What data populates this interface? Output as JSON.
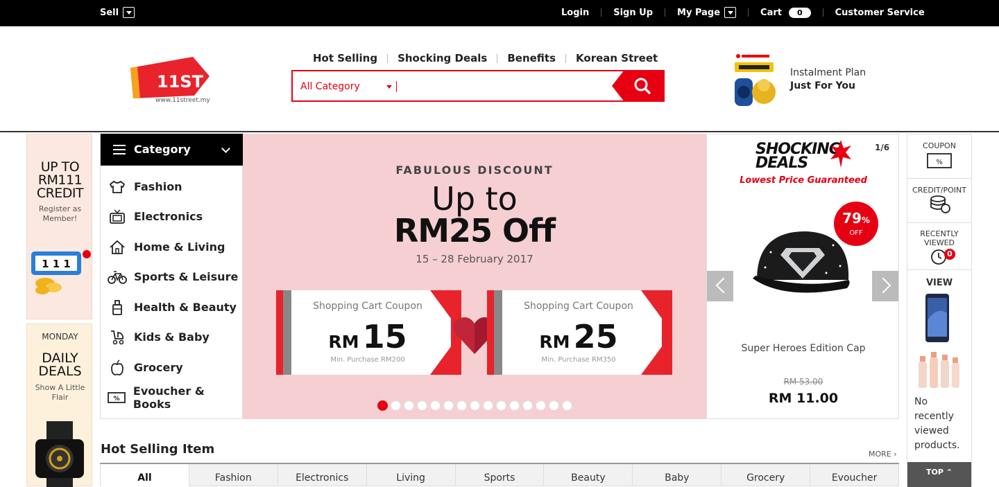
{
  "topbar": {
    "sell": "Sell",
    "login": "Login",
    "signup": "Sign Up",
    "mypage": "My Page",
    "cart": "Cart",
    "cart_count": "0",
    "customer_service": "Customer Service"
  },
  "header": {
    "logo_text": "11ST",
    "logo_url": "www.11street.my",
    "quicklinks": [
      "Hot Selling",
      "Shocking Deals",
      "Benefits",
      "Korean Street"
    ],
    "search_category": "All Category",
    "promo_line1": "Instalment Plan",
    "promo_line2": "Just For You"
  },
  "side_banners": {
    "credit_big": "UP TO RM111 CREDIT",
    "credit_small": "Register as Member!",
    "credit_graphic": "1 1 1",
    "daily_day": "MONDAY",
    "daily_big": "DAILY DEALS",
    "daily_small": "Show A Little Flair"
  },
  "category_menu": {
    "title": "Category",
    "items": [
      "Fashion",
      "Electronics",
      "Home & Living",
      "Sports & Leisure",
      "Health & Beauty",
      "Kids & Baby",
      "Grocery",
      "Evoucher & Books"
    ]
  },
  "main_banner": {
    "eyebrow": "FABULOUS DISCOUNT",
    "headline1": "Up to",
    "headline2": "RM25 Off",
    "dates": "15 – 28 February 2017",
    "coupons": [
      {
        "label": "Shopping Cart Coupon",
        "currency": "RM",
        "amount": "15",
        "min": "Min. Purchase RM200"
      },
      {
        "label": "Shopping Cart Coupon",
        "currency": "RM",
        "amount": "25",
        "min": "Min. Purchase RM350"
      }
    ],
    "slide_count": 15,
    "active_slide": 1
  },
  "shocking_deals": {
    "logo_line1": "SHOCKING",
    "logo_line2": "DEALS",
    "pager": "1/6",
    "tagline": "Lowest Price Guaranteed",
    "discount": "79",
    "discount_unit": "%",
    "discount_label": "OFF",
    "product_name": "Super Heroes Edition Cap",
    "old_price": "RM 53.00",
    "new_price": "RM 11.00"
  },
  "quick_bar": {
    "coupon": "COUPON",
    "coupon_icon": "%",
    "credit_point": "CREDIT/POINT",
    "recently_viewed": "RECENTLY VIEWED",
    "recent_count": "0",
    "view": "VIEW",
    "no_recent": "No recently viewed products.",
    "top": "TOP ⌃"
  },
  "hot_selling": {
    "title": "Hot Selling Item",
    "more": "MORE",
    "tabs": [
      "All",
      "Fashion",
      "Electronics",
      "Living",
      "Sports",
      "Beauty",
      "Baby",
      "Grocery",
      "Evoucher"
    ]
  },
  "colors": {
    "brand_red": "#e60012",
    "banner_pink": "#f6cfd3",
    "topbar": "#000000"
  }
}
